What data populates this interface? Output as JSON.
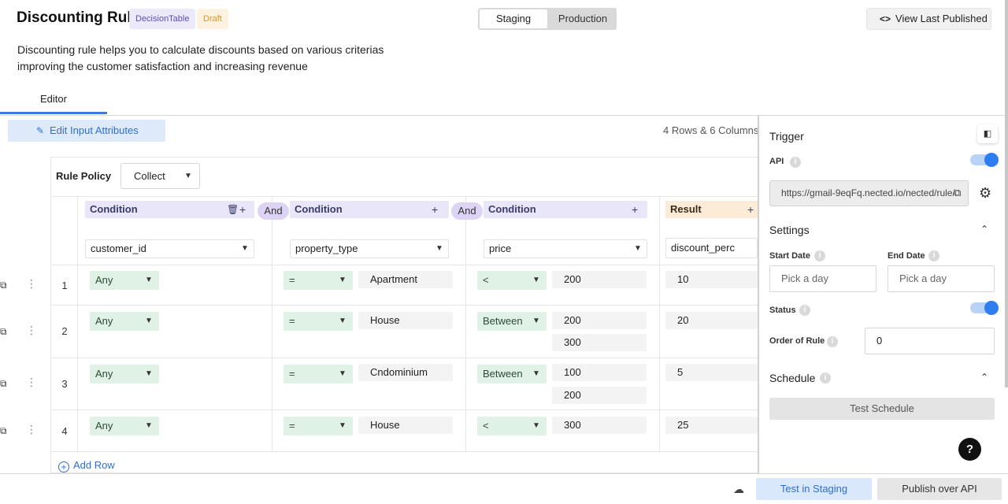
{
  "header": {
    "title": "Discounting Rule",
    "badge_type": "DecisionTable",
    "badge_status": "Draft",
    "env_staging": "Staging",
    "env_production": "Production",
    "view_last_published": "View Last Published",
    "description_line1": "Discounting rule helps you to calculate discounts based on various criterias",
    "description_line2": "improving the customer satisfaction and increasing revenue"
  },
  "tabs": {
    "editor": "Editor"
  },
  "toolbar": {
    "edit_input_attributes": "Edit Input Attributes",
    "dimensions": "4 Rows & 6 Columns"
  },
  "table": {
    "rule_policy_label": "Rule Policy",
    "rule_policy_value": "Collect",
    "and_label": "And",
    "columns": [
      {
        "header": "Condition",
        "attribute": "customer_id"
      },
      {
        "header": "Condition",
        "attribute": "property_type"
      },
      {
        "header": "Condition",
        "attribute": "price"
      }
    ],
    "result": {
      "header": "Result",
      "attribute": "discount_perc"
    },
    "rows": [
      {
        "num": "1",
        "c1_op": "Any",
        "c2_op": "=",
        "c2_val": "Apartment",
        "c3_op": "<",
        "c3_val": "200",
        "c3_val2": "",
        "result": "10"
      },
      {
        "num": "2",
        "c1_op": "Any",
        "c2_op": "=",
        "c2_val": "House",
        "c3_op": "Between",
        "c3_val": "200",
        "c3_val2": "300",
        "result": "20"
      },
      {
        "num": "3",
        "c1_op": "Any",
        "c2_op": "=",
        "c2_val": "Cndominium",
        "c3_op": "Between",
        "c3_val": "100",
        "c3_val2": "200",
        "result": "5"
      },
      {
        "num": "4",
        "c1_op": "Any",
        "c2_op": "=",
        "c2_val": "House",
        "c3_op": "<",
        "c3_val": "300",
        "c3_val2": "",
        "result": "25"
      }
    ],
    "add_row": "Add Row"
  },
  "panel": {
    "trigger_title": "Trigger",
    "api_label": "API",
    "api_enabled": true,
    "api_url": "https://gmail-9eqFq.nected.io/nected/rule/",
    "settings_title": "Settings",
    "start_date_label": "Start Date",
    "end_date_label": "End Date",
    "start_date_placeholder": "Pick a day",
    "end_date_placeholder": "Pick a day",
    "status_label": "Status",
    "status_enabled": true,
    "order_label": "Order of Rule",
    "order_value": "0",
    "schedule_title": "Schedule",
    "test_schedule": "Test Schedule"
  },
  "footer": {
    "test_in_staging": "Test in Staging",
    "publish_over_api": "Publish over API"
  },
  "colors": {
    "accent": "#2f7ef0",
    "condition_header_bg": "#e8e6f8",
    "result_header_bg": "#fcebd7",
    "operator_bg": "#e0f1e5"
  }
}
